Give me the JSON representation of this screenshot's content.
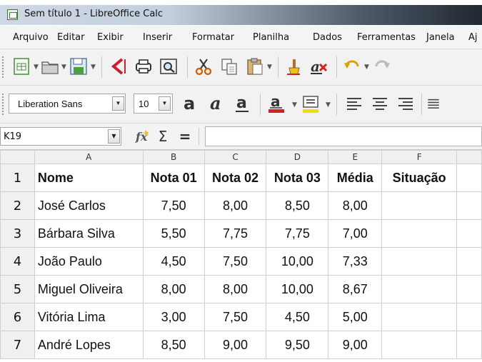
{
  "window": {
    "title": "Sem título 1 - LibreOffice Calc"
  },
  "menu": [
    "Arquivo",
    "Editar",
    "Exibir",
    "Inserir",
    "Formatar",
    "Planilha",
    "Dados",
    "Ferramentas",
    "Janela",
    "Aj"
  ],
  "toolbar": {
    "icons": [
      "new-document-icon",
      "open-folder-icon",
      "save-icon",
      "export-pdf-icon",
      "print-icon",
      "print-preview-icon",
      "cut-icon",
      "copy-icon",
      "paste-icon",
      "clone-formatting-icon",
      "clear-formatting-icon",
      "undo-icon",
      "redo-icon"
    ]
  },
  "format": {
    "font_name": "Liberation Sans",
    "font_size": "10",
    "icons": [
      "bold-icon",
      "italic-icon",
      "underline-icon",
      "font-color-icon",
      "highlight-color-icon",
      "align-left-icon",
      "align-center-icon",
      "align-right-icon",
      "justify-icon"
    ],
    "font_color": "#d62020",
    "highlight_color": "#f0e000"
  },
  "formula_bar": {
    "name_box": "K19",
    "icons": [
      "function-wizard-icon",
      "sum-icon",
      "formula-equals-icon"
    ],
    "sum_symbol": "Σ",
    "equals_symbol": "=",
    "content": ""
  },
  "sheet": {
    "columns": [
      "A",
      "B",
      "C",
      "D",
      "E",
      "F"
    ],
    "row_numbers": [
      "1",
      "2",
      "3",
      "4",
      "5",
      "6",
      "7"
    ],
    "header": [
      "Nome",
      "Nota 01",
      "Nota 02",
      "Nota 03",
      "Média",
      "Situação"
    ],
    "rows": [
      [
        "José Carlos",
        "7,50",
        "8,00",
        "8,50",
        "8,00",
        ""
      ],
      [
        "Bárbara Silva",
        "5,50",
        "7,75",
        "7,75",
        "7,00",
        ""
      ],
      [
        "João Paulo",
        "4,50",
        "7,50",
        "10,00",
        "7,33",
        ""
      ],
      [
        "Miguel Oliveira",
        "8,00",
        "8,00",
        "10,00",
        "8,67",
        ""
      ],
      [
        "Vitória Lima",
        "3,00",
        "7,50",
        "4,50",
        "5,00",
        ""
      ],
      [
        "André Lopes",
        "8,50",
        "9,00",
        "9,50",
        "9,00",
        ""
      ]
    ]
  }
}
